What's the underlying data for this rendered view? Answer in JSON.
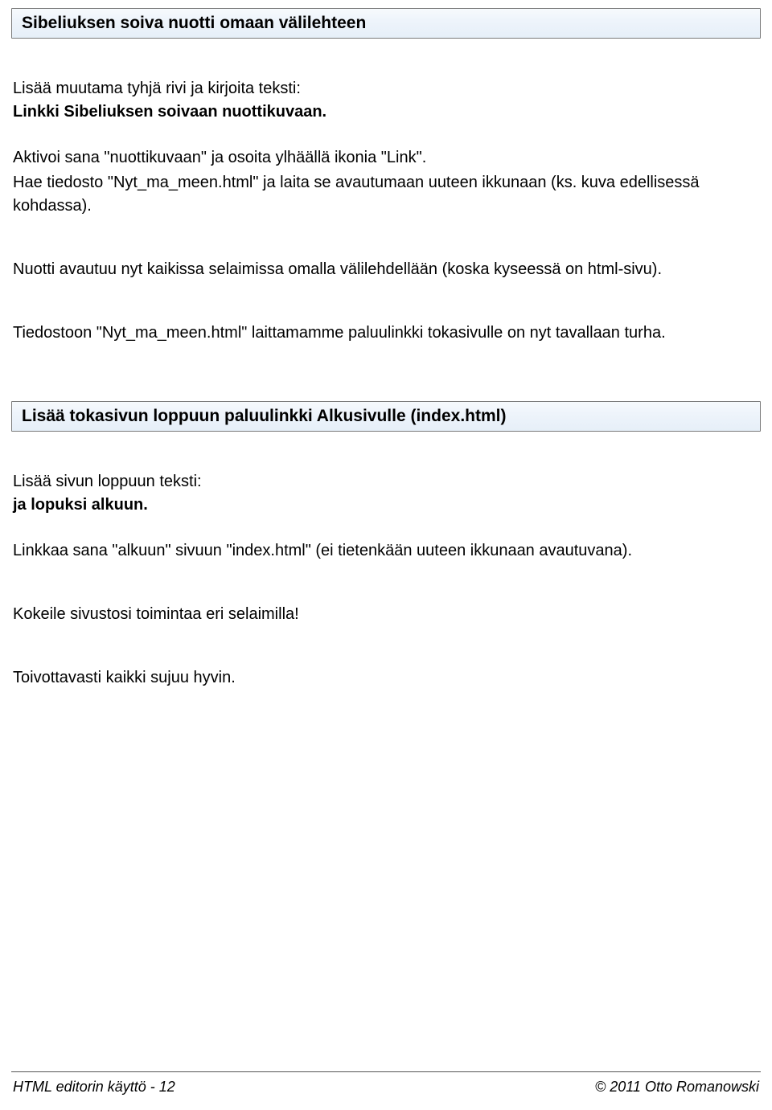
{
  "section1": {
    "heading": "Sibeliuksen soiva nuotti omaan välilehteen",
    "p1_line1": "Lisää muutama tyhjä rivi ja kirjoita teksti:",
    "p1_line2": "Linkki Sibeliuksen soivaan nuottikuvaan.",
    "p2": "Aktivoi sana \"nuottikuvaan\" ja osoita ylhäällä ikonia \"Link\".",
    "p3": "Hae tiedosto \"Nyt_ma_meen.html\" ja laita se avautumaan uuteen ikkunaan (ks. kuva edellisessä kohdassa).",
    "p4": "Nuotti avautuu nyt kaikissa selaimissa omalla välilehdellään (koska kyseessä on html-sivu).",
    "p5": "Tiedostoon \"Nyt_ma_meen.html\" laittamamme paluulinkki tokasivulle on nyt tavallaan turha."
  },
  "section2": {
    "heading": "Lisää tokasivun loppuun paluulinkki Alkusivulle (index.html)",
    "p1_line1": "Lisää sivun loppuun teksti:",
    "p1_line2": "ja lopuksi alkuun.",
    "p2": "Linkkaa sana \"alkuun\" sivuun \"index.html\" (ei tietenkään uuteen ikkunaan avautuvana).",
    "p3": "Kokeile sivustosi toimintaa eri selaimilla!",
    "p4": "Toivottavasti kaikki sujuu hyvin."
  },
  "footer": {
    "left": "HTML editorin käyttö - 12",
    "right": "© 2011 Otto Romanowski"
  }
}
